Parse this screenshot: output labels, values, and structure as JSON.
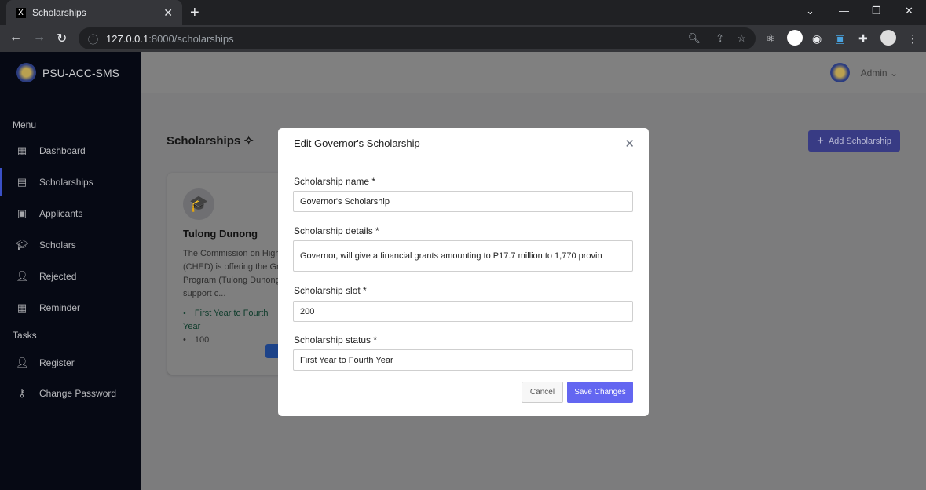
{
  "browser": {
    "tab_title": "Scholarships",
    "url_host": "127.0.0.1",
    "url_path": ":8000/scholarships"
  },
  "sidebar": {
    "brand": "PSU-ACC-SMS",
    "menu_label": "Menu",
    "tasks_label": "Tasks",
    "items": [
      {
        "label": "Dashboard",
        "icon": "dashboard-icon"
      },
      {
        "label": "Scholarships",
        "icon": "document-icon"
      },
      {
        "label": "Applicants",
        "icon": "id-card-icon"
      },
      {
        "label": "Scholars",
        "icon": "graduation-cap-icon"
      },
      {
        "label": "Rejected",
        "icon": "user-x-icon"
      },
      {
        "label": "Reminder",
        "icon": "calendar-icon"
      }
    ],
    "tasks": [
      {
        "label": "Register",
        "icon": "user-plus-icon"
      },
      {
        "label": "Change Password",
        "icon": "key-icon"
      }
    ]
  },
  "header": {
    "user": "Admin"
  },
  "main": {
    "title": "Scholarships",
    "add_button": "Add Scholarship",
    "card": {
      "name": "Tulong Dunong",
      "description": "The Commission on Higher Education (CHED) is offering the Grant-in-Aid Program (Tulong Dunong Program) to support c...",
      "year": "First Year to Fourth Year",
      "slot": "100"
    }
  },
  "modal": {
    "title": "Edit Governor's Scholarship",
    "name_label": "Scholarship name *",
    "name_value": "Governor's Scholarship",
    "details_label": "Scholarship details *",
    "details_value": "Governor, will give a financial grants amounting to P17.7 million to 1,770 provin",
    "slot_label": "Scholarship slot *",
    "slot_value": "200",
    "status_label": "Scholarship status *",
    "status_value": "First Year to Fourth Year",
    "cancel": "Cancel",
    "save": "Save Changes"
  },
  "colors": {
    "accent": "#6366f1",
    "sidebar": "#060914"
  }
}
